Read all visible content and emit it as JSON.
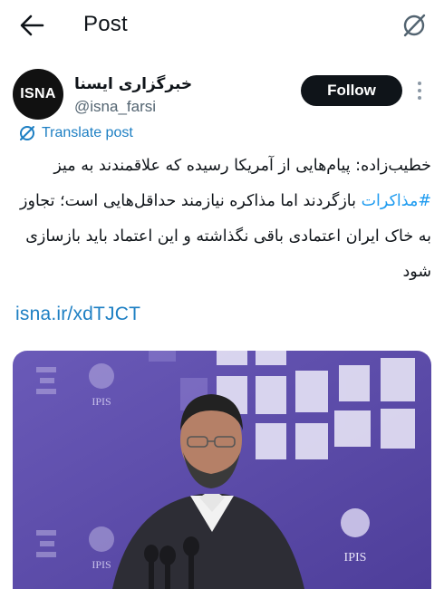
{
  "header": {
    "title": "Post",
    "back_icon": "arrow-left-icon",
    "grok_icon": "grok-icon"
  },
  "author": {
    "display_name": "خبرگزاری ایسنا",
    "handle": "@isna_farsi",
    "avatar_text": "ISNA",
    "follow_label": "Follow",
    "more_icon": "more-vertical-icon"
  },
  "translate": {
    "label": "Translate post",
    "icon": "translate-icon"
  },
  "tweet": {
    "text_before": "خطیب‌زاده: پیام‌هایی از آمریکا رسیده که علاقمندند به میز ",
    "hashtag": "#مذاکرات",
    "text_after": " بازگردند اما مذاکره نیازمند حداقل‌هایی است؛ تجاوز به خاک ایران اعتمادی باقی نگذاشته و این اعتماد باید بازسازی شود",
    "link": "isna.ir/xdTJCT"
  },
  "media": {
    "logo_label": "IPIS",
    "colors": {
      "background": "#5a4aa8",
      "suit": "#2d2d35",
      "tile": "#d9d6ef",
      "link": "#1d7fc3",
      "follow": "#0f1419"
    }
  }
}
